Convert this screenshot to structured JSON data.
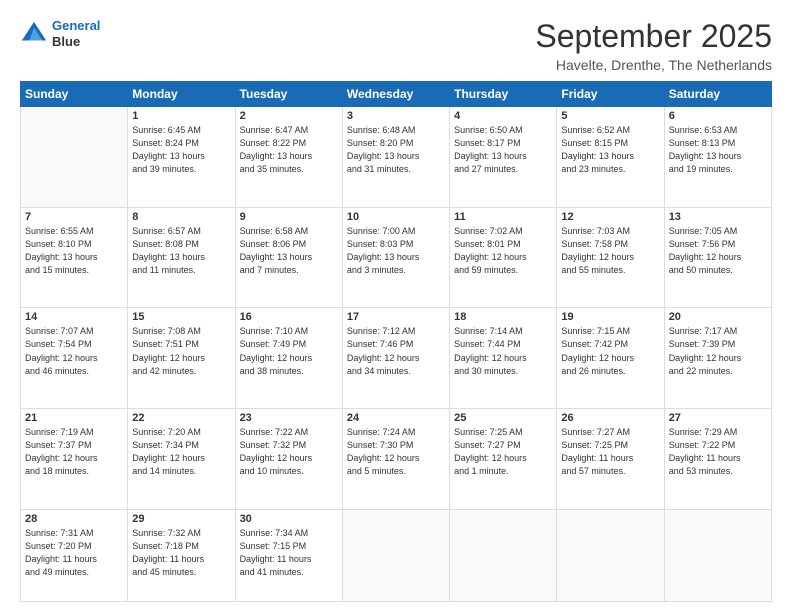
{
  "header": {
    "logo_line1": "General",
    "logo_line2": "Blue",
    "month": "September 2025",
    "location": "Havelte, Drenthe, The Netherlands"
  },
  "days_of_week": [
    "Sunday",
    "Monday",
    "Tuesday",
    "Wednesday",
    "Thursday",
    "Friday",
    "Saturday"
  ],
  "weeks": [
    [
      {
        "day": "",
        "info": ""
      },
      {
        "day": "1",
        "info": "Sunrise: 6:45 AM\nSunset: 8:24 PM\nDaylight: 13 hours\nand 39 minutes."
      },
      {
        "day": "2",
        "info": "Sunrise: 6:47 AM\nSunset: 8:22 PM\nDaylight: 13 hours\nand 35 minutes."
      },
      {
        "day": "3",
        "info": "Sunrise: 6:48 AM\nSunset: 8:20 PM\nDaylight: 13 hours\nand 31 minutes."
      },
      {
        "day": "4",
        "info": "Sunrise: 6:50 AM\nSunset: 8:17 PM\nDaylight: 13 hours\nand 27 minutes."
      },
      {
        "day": "5",
        "info": "Sunrise: 6:52 AM\nSunset: 8:15 PM\nDaylight: 13 hours\nand 23 minutes."
      },
      {
        "day": "6",
        "info": "Sunrise: 6:53 AM\nSunset: 8:13 PM\nDaylight: 13 hours\nand 19 minutes."
      }
    ],
    [
      {
        "day": "7",
        "info": "Sunrise: 6:55 AM\nSunset: 8:10 PM\nDaylight: 13 hours\nand 15 minutes."
      },
      {
        "day": "8",
        "info": "Sunrise: 6:57 AM\nSunset: 8:08 PM\nDaylight: 13 hours\nand 11 minutes."
      },
      {
        "day": "9",
        "info": "Sunrise: 6:58 AM\nSunset: 8:06 PM\nDaylight: 13 hours\nand 7 minutes."
      },
      {
        "day": "10",
        "info": "Sunrise: 7:00 AM\nSunset: 8:03 PM\nDaylight: 13 hours\nand 3 minutes."
      },
      {
        "day": "11",
        "info": "Sunrise: 7:02 AM\nSunset: 8:01 PM\nDaylight: 12 hours\nand 59 minutes."
      },
      {
        "day": "12",
        "info": "Sunrise: 7:03 AM\nSunset: 7:58 PM\nDaylight: 12 hours\nand 55 minutes."
      },
      {
        "day": "13",
        "info": "Sunrise: 7:05 AM\nSunset: 7:56 PM\nDaylight: 12 hours\nand 50 minutes."
      }
    ],
    [
      {
        "day": "14",
        "info": "Sunrise: 7:07 AM\nSunset: 7:54 PM\nDaylight: 12 hours\nand 46 minutes."
      },
      {
        "day": "15",
        "info": "Sunrise: 7:08 AM\nSunset: 7:51 PM\nDaylight: 12 hours\nand 42 minutes."
      },
      {
        "day": "16",
        "info": "Sunrise: 7:10 AM\nSunset: 7:49 PM\nDaylight: 12 hours\nand 38 minutes."
      },
      {
        "day": "17",
        "info": "Sunrise: 7:12 AM\nSunset: 7:46 PM\nDaylight: 12 hours\nand 34 minutes."
      },
      {
        "day": "18",
        "info": "Sunrise: 7:14 AM\nSunset: 7:44 PM\nDaylight: 12 hours\nand 30 minutes."
      },
      {
        "day": "19",
        "info": "Sunrise: 7:15 AM\nSunset: 7:42 PM\nDaylight: 12 hours\nand 26 minutes."
      },
      {
        "day": "20",
        "info": "Sunrise: 7:17 AM\nSunset: 7:39 PM\nDaylight: 12 hours\nand 22 minutes."
      }
    ],
    [
      {
        "day": "21",
        "info": "Sunrise: 7:19 AM\nSunset: 7:37 PM\nDaylight: 12 hours\nand 18 minutes."
      },
      {
        "day": "22",
        "info": "Sunrise: 7:20 AM\nSunset: 7:34 PM\nDaylight: 12 hours\nand 14 minutes."
      },
      {
        "day": "23",
        "info": "Sunrise: 7:22 AM\nSunset: 7:32 PM\nDaylight: 12 hours\nand 10 minutes."
      },
      {
        "day": "24",
        "info": "Sunrise: 7:24 AM\nSunset: 7:30 PM\nDaylight: 12 hours\nand 5 minutes."
      },
      {
        "day": "25",
        "info": "Sunrise: 7:25 AM\nSunset: 7:27 PM\nDaylight: 12 hours\nand 1 minute."
      },
      {
        "day": "26",
        "info": "Sunrise: 7:27 AM\nSunset: 7:25 PM\nDaylight: 11 hours\nand 57 minutes."
      },
      {
        "day": "27",
        "info": "Sunrise: 7:29 AM\nSunset: 7:22 PM\nDaylight: 11 hours\nand 53 minutes."
      }
    ],
    [
      {
        "day": "28",
        "info": "Sunrise: 7:31 AM\nSunset: 7:20 PM\nDaylight: 11 hours\nand 49 minutes."
      },
      {
        "day": "29",
        "info": "Sunrise: 7:32 AM\nSunset: 7:18 PM\nDaylight: 11 hours\nand 45 minutes."
      },
      {
        "day": "30",
        "info": "Sunrise: 7:34 AM\nSunset: 7:15 PM\nDaylight: 11 hours\nand 41 minutes."
      },
      {
        "day": "",
        "info": ""
      },
      {
        "day": "",
        "info": ""
      },
      {
        "day": "",
        "info": ""
      },
      {
        "day": "",
        "info": ""
      }
    ]
  ]
}
